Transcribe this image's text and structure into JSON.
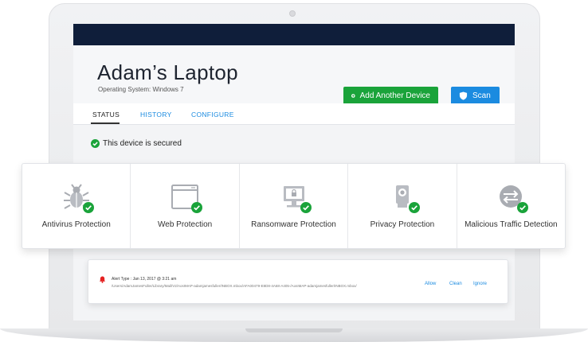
{
  "device": {
    "name": "Adam’s Laptop",
    "os_line": "Operating System: Windows 7"
  },
  "actions": {
    "add_device_label": "Add Another Device",
    "scan_label": "Scan"
  },
  "tabs": [
    {
      "label": "STATUS",
      "active": true
    },
    {
      "label": "HISTORY",
      "active": false
    },
    {
      "label": "CONFIGURE",
      "active": false
    }
  ],
  "status": {
    "message": "This device is secured",
    "icon": "check-circle-icon"
  },
  "protections": [
    {
      "label": "Antivirus Protection",
      "icon": "bug-icon",
      "state": "protected"
    },
    {
      "label": "Web Protection",
      "icon": "browser-window-icon",
      "state": "protected"
    },
    {
      "label": "Ransomware Protection",
      "icon": "locked-monitor-icon",
      "state": "protected"
    },
    {
      "label": "Privacy Protection",
      "icon": "webcam-icon",
      "state": "protected"
    },
    {
      "label": "Malicious Traffic Detection",
      "icon": "traffic-arrows-icon",
      "state": "protected"
    }
  ],
  "alert": {
    "icon": "bell-icon",
    "type_line": "Alert Type : Jan 13, 2017 @ 3:21 am",
    "path": "/Users/AdamJamesFuller/Library/Mail/V2/AosIMAP-adamjamesfuller/INBOX.mbox/AFA00479-E8D8-4A68-A405-/AosIMAP-adamjamesfuller/INBOX.mbox/",
    "actions": {
      "allow": "Allow",
      "clean": "Clean",
      "ignore": "Ignore"
    }
  },
  "colors": {
    "primary_blue": "#1b8be0",
    "success_green": "#1aa33a",
    "topbar_navy": "#0f1e3a",
    "alert_red": "#e52222"
  }
}
